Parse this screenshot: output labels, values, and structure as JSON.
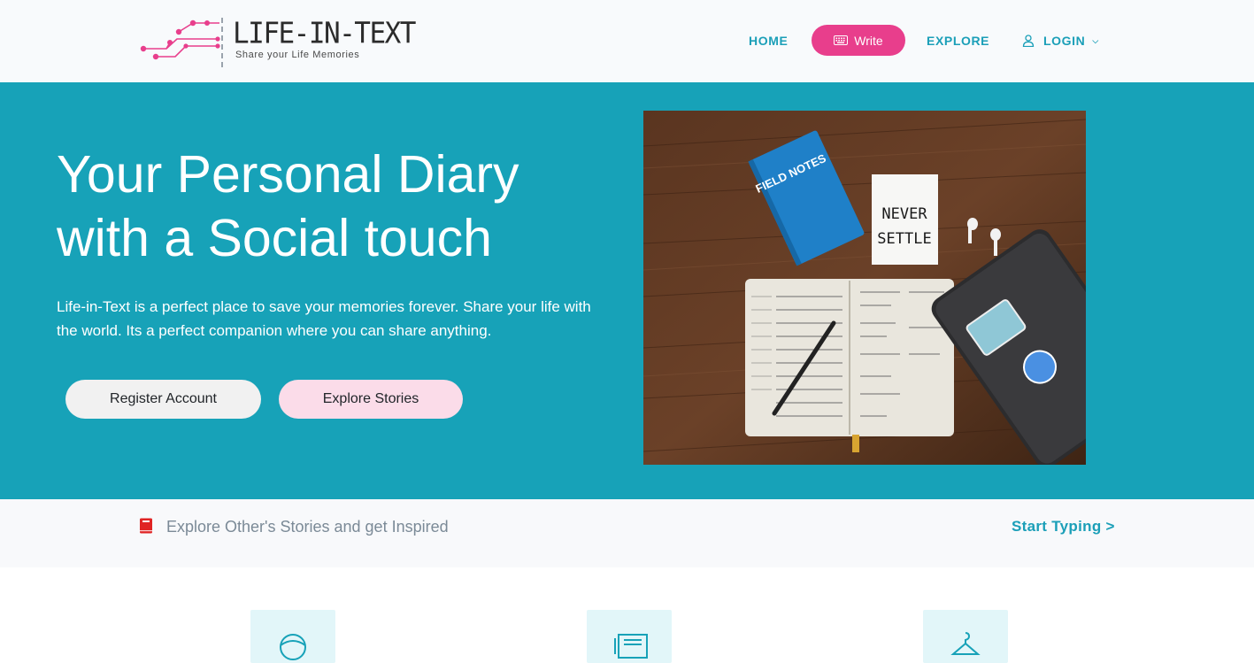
{
  "brand": {
    "title": "LIFE-IN-TEXT",
    "tagline": "Share your Life Memories",
    "accent": "#e83e8c",
    "primary": "#17a2b8"
  },
  "nav": {
    "home": "HOME",
    "write": "Write",
    "explore": "EXPLORE",
    "login": "LOGIN"
  },
  "hero": {
    "title_line1": "Your Personal Diary",
    "title_line2": "with a Social touch",
    "text": "Life-in-Text is a perfect place to save your memories forever. Share your life with the world. Its a perfect companion where you can share anything.",
    "register_label": "Register Account",
    "explore_label": "Explore Stories",
    "photo_texts": {
      "field_notes": "FIELD NOTES",
      "card_line1": "NEVER",
      "card_line2": "SETTLE"
    }
  },
  "strip": {
    "text": "Explore Other's Stories and get Inspired",
    "link": "Start Typing >"
  },
  "features": {
    "icons": [
      "globe-icon",
      "newspaper-icon",
      "hanger-icon"
    ]
  }
}
